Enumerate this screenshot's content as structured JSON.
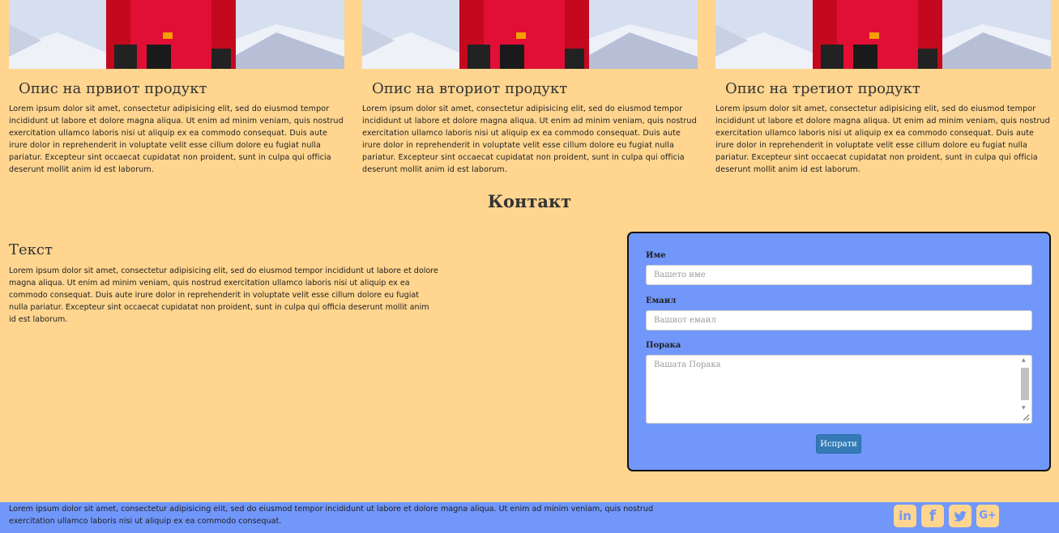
{
  "products": [
    {
      "title": "Опис на првиот продукт",
      "text": "Lorem ipsum dolor sit amet, consectetur adipisicing elit, sed do eiusmod tempor incididunt ut labore et dolore magna aliqua. Ut enim ad minim veniam, quis nostrud exercitation ullamco laboris nisi ut aliquip ex ea commodo consequat. Duis aute irure dolor in reprehenderit in voluptate velit esse cillum dolore eu fugiat nulla pariatur. Excepteur sint occaecat cupidatat non proident, sunt in culpa qui officia deserunt mollit anim id est laborum."
    },
    {
      "title": "Опис на вториот продукт",
      "text": "Lorem ipsum dolor sit amet, consectetur adipisicing elit, sed do eiusmod tempor incididunt ut labore et dolore magna aliqua. Ut enim ad minim veniam, quis nostrud exercitation ullamco laboris nisi ut aliquip ex ea commodo consequat. Duis aute irure dolor in reprehenderit in voluptate velit esse cillum dolore eu fugiat nulla pariatur. Excepteur sint occaecat cupidatat non proident, sunt in culpa qui officia deserunt mollit anim id est laborum."
    },
    {
      "title": "Опис на третиот продукт",
      "text": "Lorem ipsum dolor sit amet, consectetur adipisicing elit, sed do eiusmod tempor incididunt ut labore et dolore magna aliqua. Ut enim ad minim veniam, quis nostrud exercitation ullamco laboris nisi ut aliquip ex ea commodo consequat. Duis aute irure dolor in reprehenderit in voluptate velit esse cillum dolore eu fugiat nulla pariatur. Excepteur sint occaecat cupidatat non proident, sunt in culpa qui officia deserunt mollit anim id est laborum."
    }
  ],
  "contact": {
    "heading": "Контакт",
    "left_title": "Текст",
    "left_text": "Lorem ipsum dolor sit amet, consectetur adipisicing elit, sed do eiusmod tempor incididunt ut labore et dolore magna aliqua. Ut enim ad minim veniam, quis nostrud exercitation ullamco laboris nisi ut aliquip ex ea commodo consequat. Duis aute irure dolor in reprehenderit in voluptate velit esse cillum dolore eu fugiat nulla pariatur. Excepteur sint occaecat cupidatat non proident, sunt in culpa qui officia deserunt mollit anim id est laborum."
  },
  "form": {
    "name_label": "Име",
    "name_placeholder": "Вашето име",
    "email_label": "Емаил",
    "email_placeholder": "Вашиот емаил",
    "message_label": "Порака",
    "message_placeholder": "Вашата Порака",
    "submit_label": "Испрати"
  },
  "footer": {
    "text": "Lorem ipsum dolor sit amet, consectetur adipisicing elit, sed do eiusmod tempor incididunt ut labore et dolore magna aliqua. Ut enim ad minim veniam, quis nostrud exercitation ullamco laboris nisi ut aliquip ex ea commodo consequat.",
    "social": [
      {
        "icon": "linkedin-icon",
        "glyph": "in"
      },
      {
        "icon": "facebook-icon",
        "glyph": "f"
      },
      {
        "icon": "twitter-icon",
        "glyph": "🐦"
      },
      {
        "icon": "google-plus-icon",
        "glyph": "G+"
      }
    ]
  },
  "colors": {
    "background": "#ffd58f",
    "accent": "#7197fb",
    "button": "#337ab7"
  }
}
